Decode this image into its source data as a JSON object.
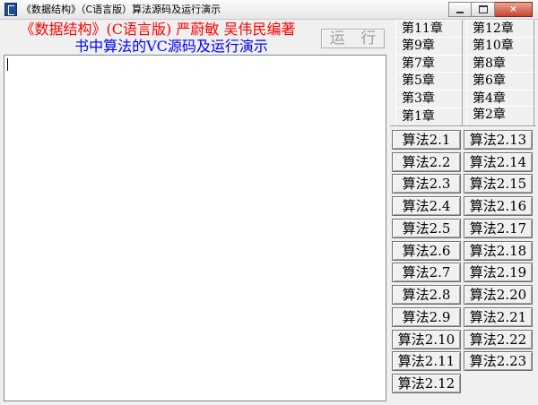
{
  "window": {
    "title": "《数据结构》（C语言版）算法源码及运行演示",
    "controls": {
      "minimize": "",
      "maximize": "",
      "close": "×"
    }
  },
  "header": {
    "line1": "《数据结构》(C语言版) 严蔚敏 吴伟民编著",
    "line2": "书中算法的VC源码及运行演示"
  },
  "run_button": {
    "label": "运 行"
  },
  "output": {
    "text": ""
  },
  "chapter_tabs": [
    {
      "label": "第11章"
    },
    {
      "label": "第12章"
    },
    {
      "label": "第9章"
    },
    {
      "label": "第10章"
    },
    {
      "label": "第7章"
    },
    {
      "label": "第8章"
    },
    {
      "label": "第5章"
    },
    {
      "label": "第6章"
    },
    {
      "label": "第3章"
    },
    {
      "label": "第4章"
    },
    {
      "label": "第1章"
    },
    {
      "label": "第2章"
    }
  ],
  "active_tab": "第2章",
  "algorithms": {
    "left": [
      {
        "label": "算法2.1"
      },
      {
        "label": "算法2.2"
      },
      {
        "label": "算法2.3"
      },
      {
        "label": "算法2.4"
      },
      {
        "label": "算法2.5"
      },
      {
        "label": "算法2.6"
      },
      {
        "label": "算法2.7"
      },
      {
        "label": "算法2.8"
      },
      {
        "label": "算法2.9"
      },
      {
        "label": "算法2.10"
      },
      {
        "label": "算法2.11"
      },
      {
        "label": "算法2.12"
      }
    ],
    "right": [
      {
        "label": "算法2.13"
      },
      {
        "label": "算法2.14"
      },
      {
        "label": "算法2.15"
      },
      {
        "label": "算法2.16"
      },
      {
        "label": "算法2.17"
      },
      {
        "label": "算法2.18"
      },
      {
        "label": "算法2.19"
      },
      {
        "label": "算法2.20"
      },
      {
        "label": "算法2.21"
      },
      {
        "label": "算法2.22"
      },
      {
        "label": "算法2.23"
      }
    ]
  }
}
